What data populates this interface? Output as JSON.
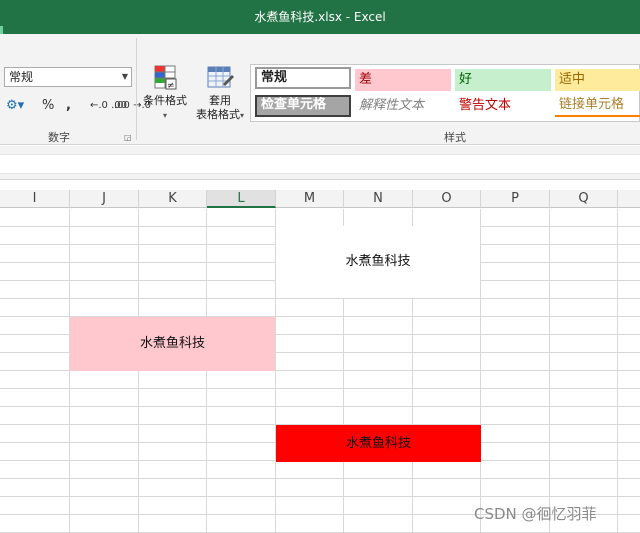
{
  "window": {
    "title": "水煮鱼科技.xlsx - Excel"
  },
  "ribbon": {
    "number_format": {
      "value": "常规"
    },
    "number_group_label": "数字",
    "number_buttons": {
      "percent": "%",
      "comma": ",",
      "inc_decimal": "←.0 .00",
      "dec_decimal": ".00 →.0"
    },
    "conditional_format": {
      "label": "条件格式",
      "dropdown": "▾"
    },
    "format_as_table": {
      "label_line1": "套用",
      "label_line2": "表格格式",
      "dropdown": "▾"
    },
    "styles_group_label": "样式",
    "cell_styles": [
      {
        "label": "常规"
      },
      {
        "label": "差"
      },
      {
        "label": "好"
      },
      {
        "label": "适中"
      },
      {
        "label": "检查单元格"
      },
      {
        "label": "解释性文本"
      },
      {
        "label": "警告文本"
      },
      {
        "label": "链接单元格"
      }
    ]
  },
  "columns": [
    "I",
    "J",
    "K",
    "L",
    "M",
    "N",
    "O",
    "P",
    "Q"
  ],
  "selected_column": "L",
  "cells": {
    "white_cell": {
      "text": "水煮鱼科技",
      "fill": "#ffffff"
    },
    "pink_cell": {
      "text": "水煮鱼科技",
      "fill": "#ffc7ce"
    },
    "red_cell": {
      "text": "水煮鱼科技",
      "fill": "#ff0000"
    }
  },
  "watermark": "CSDN @徊忆羽菲",
  "colors": {
    "title_bar": "#217346",
    "accent": "#217346"
  }
}
